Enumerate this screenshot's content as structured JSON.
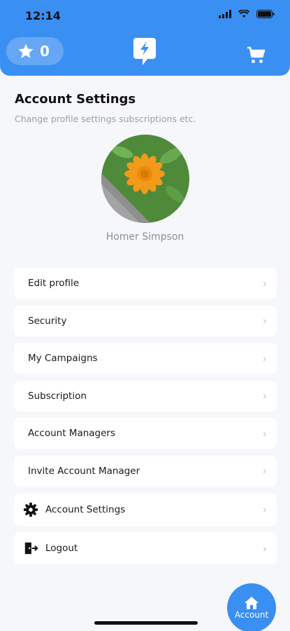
{
  "status": {
    "time": "12:14"
  },
  "header": {
    "star_count": "0"
  },
  "page": {
    "title": "Account Settings",
    "subtitle": "Change profile settings subscriptions etc."
  },
  "profile": {
    "name": "Homer Simpson"
  },
  "menu": {
    "items": [
      {
        "label": "Edit profile"
      },
      {
        "label": "Security"
      },
      {
        "label": "My Campaigns"
      },
      {
        "label": "Subscription"
      },
      {
        "label": "Account Managers"
      },
      {
        "label": "Invite Account Manager"
      },
      {
        "label": "Account Settings",
        "icon": "gear-icon"
      },
      {
        "label": "Logout",
        "icon": "logout-icon"
      }
    ]
  },
  "fab": {
    "label": "Account",
    "icon": "home-icon"
  },
  "colors": {
    "accent": "#3a8ff2",
    "background": "#f5f7fb"
  }
}
